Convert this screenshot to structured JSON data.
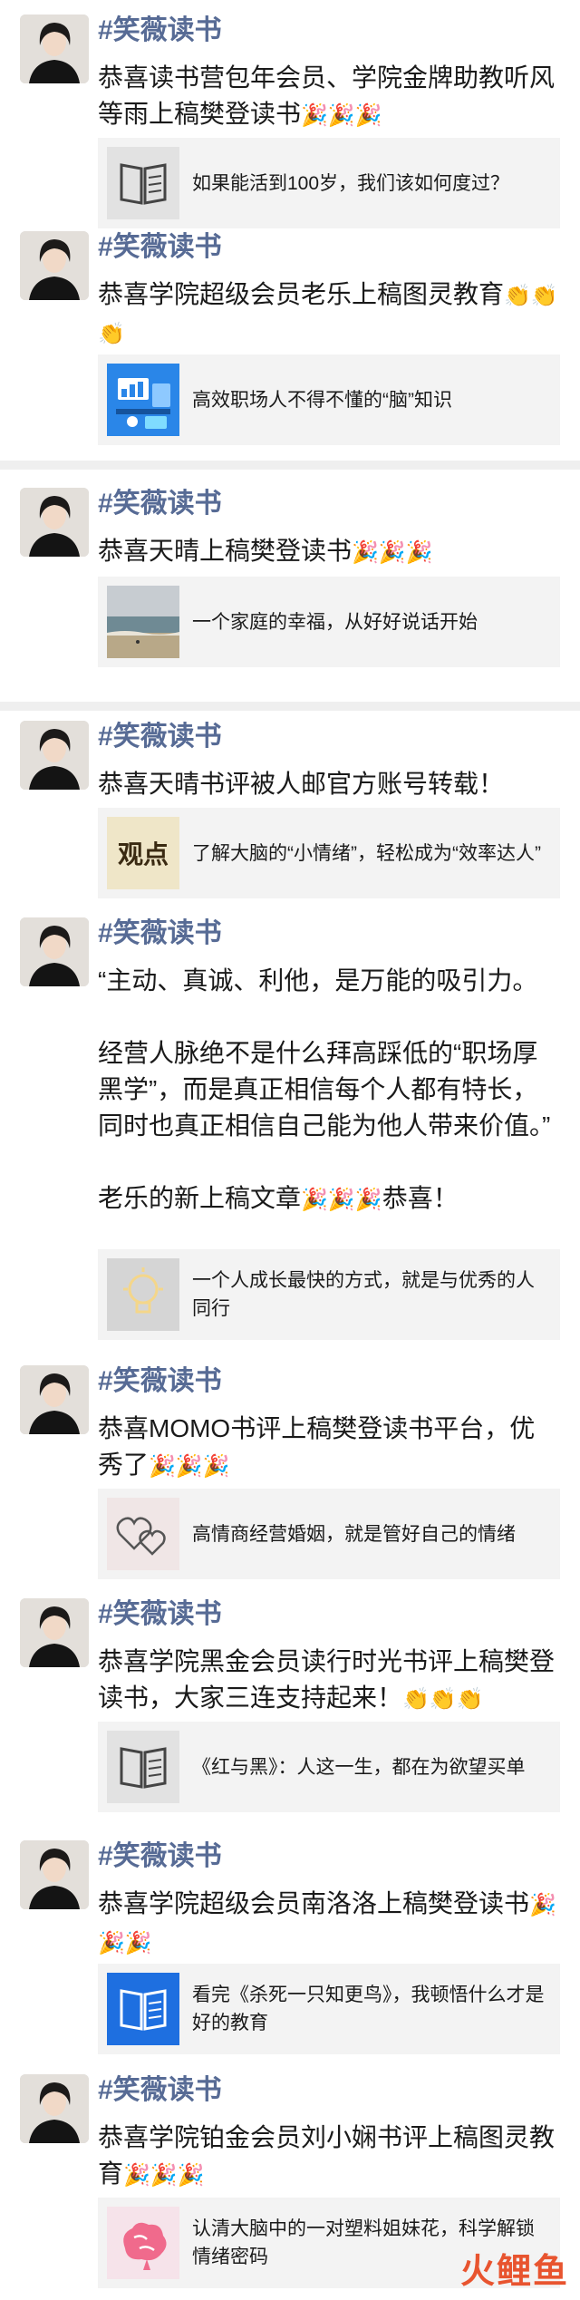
{
  "author_name": "#笑薇读书",
  "emoji": {
    "party": "🎉",
    "clap": "👏"
  },
  "posts": [
    {
      "text": "恭喜读书营包年会员、学院金牌助教听风等雨上稿樊登读书",
      "card_title": "如果能活到100岁，我们该如何度过？",
      "card_icon": "book-icon"
    },
    {
      "text": "恭喜学院超级会员老乐上稿图灵教育",
      "card_title": "高效职场人不得不懂的“脑”知识",
      "card_icon": "office-illustration"
    },
    {
      "text": "恭喜天晴上稿樊登读书",
      "card_title": "一个家庭的幸福，从好好说话开始",
      "card_icon": "beach-photo"
    },
    {
      "text": "恭喜天晴书评被人邮官方账号转载！",
      "card_title": "了解大脑的“小情绪”，轻松成为“效率达人”",
      "card_icon": "viewpoint-logo",
      "card_icon_text": "观点"
    },
    {
      "paragraphs": [
        "“主动、真诚、利他，是万能的吸引力。",
        "经营人脉绝不是什么拜高踩低的“职场厚黑学”，而是真正相信每个人都有特长，同时也真正相信自己能为他人带来价值。”",
        "老乐的新上稿文章"
      ],
      "text_suffix": "恭喜！",
      "card_title": "一个人成长最快的方式，就是与优秀的人同行",
      "card_icon": "lightbulb-icon"
    },
    {
      "text": "恭喜MOMO书评上稿樊登读书平台，优秀了",
      "card_title": "高情商经营婚姻，就是管好自己的情绪",
      "card_icon": "hearts-icon"
    },
    {
      "text": "恭喜学院黑金会员读行时光书评上稿樊登读书，大家三连支持起来！",
      "card_title": "《红与黑》：人这一生，都在为欲望买单",
      "card_icon": "book-icon"
    },
    {
      "text": "恭喜学院超级会员南洛洛上稿樊登读书",
      "card_title": "看完《杀死一只知更鸟》，我顿悟什么才是好的教育",
      "card_icon": "book-icon-blue"
    },
    {
      "text": "恭喜学院铂金会员刘小娴书评上稿图灵教育",
      "card_title": "认清大脑中的一对塑料姐妹花，科学解锁情绪密码",
      "card_icon": "brain-illustration"
    }
  ],
  "watermark": "火鲤鱼"
}
